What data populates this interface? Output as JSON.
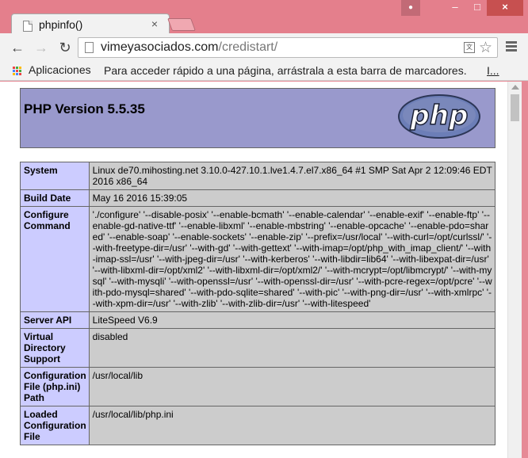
{
  "browser": {
    "tab_title": "phpinfo()",
    "tab_close": "×",
    "url_domain": "vimeyasociados.com",
    "url_path": "/credistart/",
    "apps_label": "Aplicaciones",
    "bookmarks_hint": "Para acceder rápido a una página, arrástrala a esta barra de marcadores.",
    "bookmarks_link": "I...",
    "window_controls": {
      "minimize": "–",
      "maximize": "□",
      "close": "×"
    },
    "icons": [
      "back-icon",
      "forward-icon",
      "reload-icon",
      "page-icon",
      "translate-icon",
      "star-icon",
      "menu-icon",
      "apps-icon",
      "user-icon"
    ]
  },
  "page": {
    "title": "PHP Version 5.5.35",
    "logo_text": "php",
    "rows": [
      {
        "label": "System",
        "value": "Linux de70.mihosting.net 3.10.0-427.10.1.lve1.4.7.el7.x86_64 #1 SMP Sat Apr 2 12:09:46 EDT 2016 x86_64"
      },
      {
        "label": "Build Date",
        "value": "May 16 2016 15:39:05"
      },
      {
        "label": "Configure Command",
        "value": "'./configure' '--disable-posix' '--enable-bcmath' '--enable-calendar' '--enable-exif' '--enable-ftp' '--enable-gd-native-ttf' '--enable-libxml' '--enable-mbstring' '--enable-opcache' '--enable-pdo=shared' '--enable-soap' '--enable-sockets' '--enable-zip' '--prefix=/usr/local' '--with-curl=/opt/curlssl/' '--with-freetype-dir=/usr' '--with-gd' '--with-gettext' '--with-imap=/opt/php_with_imap_client/' '--with-imap-ssl=/usr' '--with-jpeg-dir=/usr' '--with-kerberos' '--with-libdir=lib64' '--with-libexpat-dir=/usr' '--with-libxml-dir=/opt/xml2' '--with-libxml-dir=/opt/xml2/' '--with-mcrypt=/opt/libmcrypt/' '--with-mysql' '--with-mysqli' '--with-openssl=/usr' '--with-openssl-dir=/usr' '--with-pcre-regex=/opt/pcre' '--with-pdo-mysql=shared' '--with-pdo-sqlite=shared' '--with-pic' '--with-png-dir=/usr' '--with-xmlrpc' '--with-xpm-dir=/usr' '--with-zlib' '--with-zlib-dir=/usr' '--with-litespeed'"
      },
      {
        "label": "Server API",
        "value": "LiteSpeed V6.9"
      },
      {
        "label": "Virtual Directory Support",
        "value": "disabled"
      },
      {
        "label": "Configuration File (php.ini) Path",
        "value": "/usr/local/lib"
      },
      {
        "label": "Loaded Configuration File",
        "value": "/usr/local/lib/php.ini"
      }
    ]
  }
}
